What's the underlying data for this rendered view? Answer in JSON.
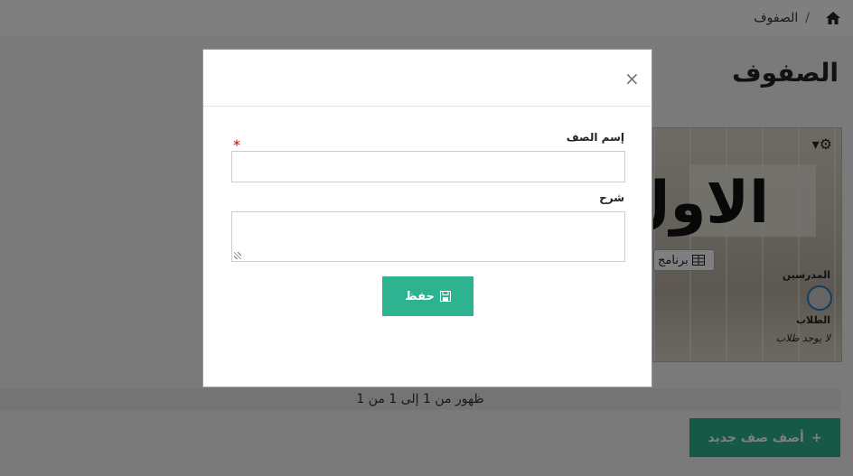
{
  "breadcrumb": {
    "home_icon": "home-icon",
    "separator": "/",
    "current": "الصفوف"
  },
  "page_title": "الصفوف",
  "class_card": {
    "title": "الاول",
    "settings_icon": "gear-icon",
    "program_label": "برنامج",
    "teachers_label": "المدرسين",
    "students_label": "الطلاب",
    "no_students": "لا يوجد طلاب"
  },
  "pagination_text": "ظهور من 1 إلى 1 من 1",
  "add_button_label": "أضف صف جديد",
  "modal": {
    "close_symbol": "×",
    "name_label": "إسم الصف",
    "required_mark": "*",
    "name_value": "",
    "description_label": "شرح",
    "description_value": "",
    "save_label": "حفظ"
  },
  "colors": {
    "accent": "#2eb28f",
    "required": "#cc0000",
    "avatar_ring": "#2a7bb8"
  }
}
